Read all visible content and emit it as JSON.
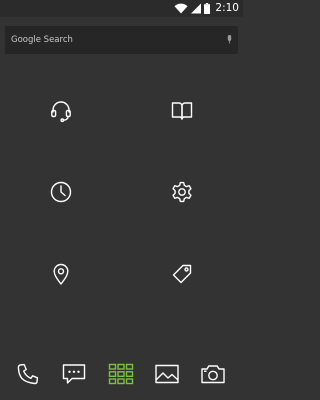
{
  "status_bar": {
    "time": "2:10",
    "icons": [
      "wifi-icon",
      "signal-icon",
      "battery-icon"
    ]
  },
  "search": {
    "placeholder": "Google Search",
    "mic_icon": "microphone-icon"
  },
  "home_apps": [
    {
      "icon": "headset-icon"
    },
    {
      "icon": "book-icon"
    },
    {
      "icon": "clock-icon"
    },
    {
      "icon": "settings-gear-icon"
    },
    {
      "icon": "location-pin-icon"
    },
    {
      "icon": "tag-icon"
    }
  ],
  "dock": [
    {
      "icon": "phone-icon"
    },
    {
      "icon": "messages-icon"
    },
    {
      "icon": "app-drawer-icon"
    },
    {
      "icon": "gallery-icon"
    },
    {
      "icon": "camera-icon"
    }
  ],
  "colors": {
    "background": "#333333",
    "status_bar": "#2b2b2b",
    "search_bar": "#262626",
    "icon_stroke": "#ffffff",
    "accent": "#7cc242"
  }
}
